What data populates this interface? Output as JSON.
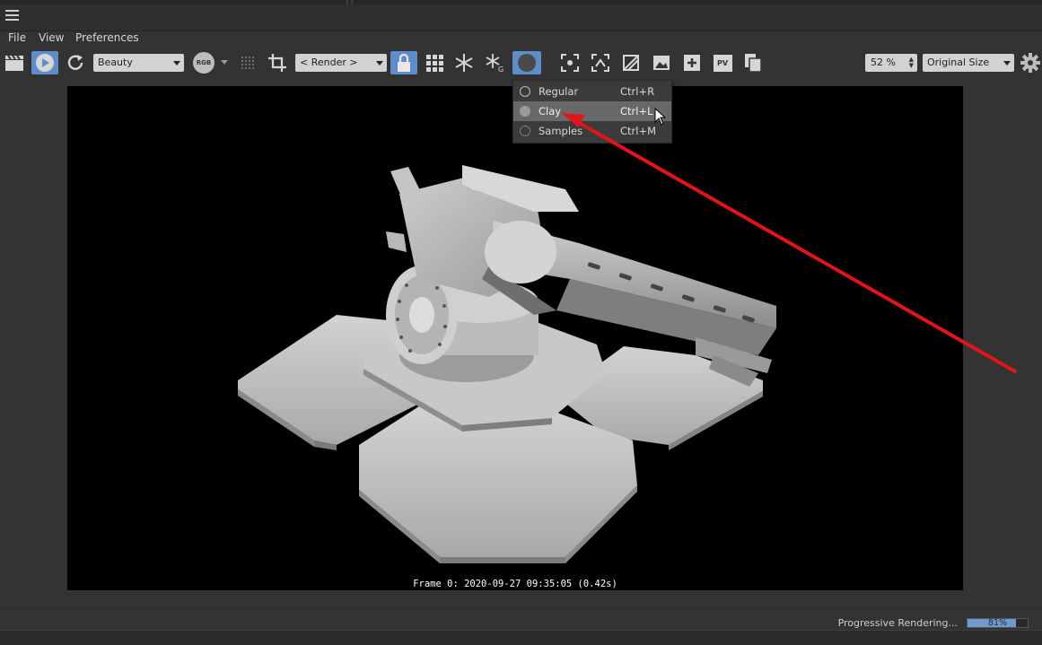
{
  "menu": [
    "File",
    "View",
    "Preferences"
  ],
  "toolbar": {
    "channel_select": "Beauty",
    "rgb_badge": "RGB",
    "render_select": "< Render >",
    "pv_label": "PV",
    "zoom_value": "52 %",
    "size_select": "Original Size",
    "icons": [
      "clapboard-icon",
      "play-icon",
      "refresh-icon",
      "rgb-icon",
      "dots-icon",
      "crop-icon",
      "lock-icon",
      "grid-icon",
      "snowflake-icon",
      "snowflake-g-icon",
      "clay-mode-icon",
      "region-icon",
      "focus-icon",
      "compare-icon",
      "image-icon",
      "add-image-icon",
      "pv-icon",
      "copy-icon",
      "settings-icon"
    ]
  },
  "render_mode_menu": {
    "items": [
      {
        "label": "Regular",
        "shortcut": "Ctrl+R",
        "icon": "circle-outline-icon"
      },
      {
        "label": "Clay",
        "shortcut": "Ctrl+L",
        "icon": "circle-filled-icon",
        "highlighted": true
      },
      {
        "label": "Samples",
        "shortcut": "Ctrl+M",
        "icon": "dotted-circle-icon"
      }
    ]
  },
  "viewport": {
    "frame_info": "Frame 0: 2020-09-27 09:35:05 (0.42s)"
  },
  "status": {
    "text": "Progressive Rendering...",
    "progress_percent": 81,
    "progress_label": "81%"
  },
  "colors": {
    "accent": "#5f8dcc",
    "annotation_arrow": "#e0141b",
    "panel": "#333333"
  }
}
